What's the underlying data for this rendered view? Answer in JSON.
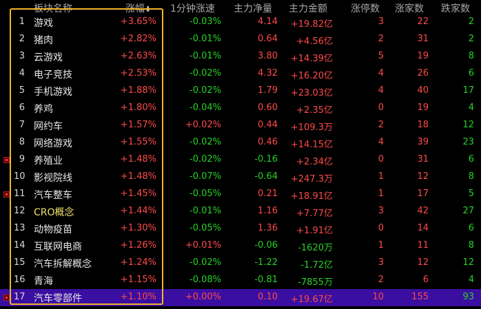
{
  "columns": {
    "name": "板块名称",
    "change": "涨幅",
    "speed": "1分钟涨速",
    "net_flow": "主力净量",
    "amount": "主力金额",
    "limit_up": "涨停数",
    "up": "涨家数",
    "down": "跌家数"
  },
  "rows": [
    {
      "no": "1",
      "name": "游戏",
      "change": "+3.65%",
      "speed": "-0.03%",
      "net": "4.14",
      "amount": "+19.82亿",
      "limit": "3",
      "up": "22",
      "down": "2",
      "marker": false
    },
    {
      "no": "2",
      "name": "猪肉",
      "change": "+2.82%",
      "speed": "-0.01%",
      "net": "0.64",
      "amount": "+4.56亿",
      "limit": "2",
      "up": "31",
      "down": "2",
      "marker": false
    },
    {
      "no": "3",
      "name": "云游戏",
      "change": "+2.63%",
      "speed": "-0.01%",
      "net": "3.80",
      "amount": "+14.39亿",
      "limit": "5",
      "up": "19",
      "down": "8",
      "marker": false
    },
    {
      "no": "4",
      "name": "电子竞技",
      "change": "+2.53%",
      "speed": "-0.02%",
      "net": "4.32",
      "amount": "+16.20亿",
      "limit": "4",
      "up": "26",
      "down": "6",
      "marker": false
    },
    {
      "no": "5",
      "name": "手机游戏",
      "change": "+1.88%",
      "speed": "-0.02%",
      "net": "1.79",
      "amount": "+23.03亿",
      "limit": "4",
      "up": "40",
      "down": "17",
      "marker": false
    },
    {
      "no": "6",
      "name": "养鸡",
      "change": "+1.80%",
      "speed": "-0.04%",
      "net": "0.60",
      "amount": "+2.35亿",
      "limit": "0",
      "up": "19",
      "down": "4",
      "marker": false
    },
    {
      "no": "7",
      "name": "网约车",
      "change": "+1.57%",
      "speed": "+0.02%",
      "net": "0.44",
      "amount": "+109.3万",
      "limit": "2",
      "up": "18",
      "down": "12",
      "marker": false
    },
    {
      "no": "8",
      "name": "网络游戏",
      "change": "+1.55%",
      "speed": "-0.02%",
      "net": "0.46",
      "amount": "+14.15亿",
      "limit": "4",
      "up": "39",
      "down": "23",
      "marker": false
    },
    {
      "no": "9",
      "name": "养殖业",
      "change": "+1.48%",
      "speed": "-0.02%",
      "net": "-0.16",
      "amount": "+2.34亿",
      "limit": "0",
      "up": "31",
      "down": "6",
      "marker": true
    },
    {
      "no": "10",
      "name": "影视院线",
      "change": "+1.48%",
      "speed": "-0.07%",
      "net": "-0.64",
      "amount": "+247.3万",
      "limit": "1",
      "up": "12",
      "down": "8",
      "marker": false
    },
    {
      "no": "11",
      "name": "汽车整车",
      "change": "+1.45%",
      "speed": "-0.05%",
      "net": "0.21",
      "amount": "+18.91亿",
      "limit": "1",
      "up": "17",
      "down": "5",
      "marker": true
    },
    {
      "no": "12",
      "name": "CRO概念",
      "change": "+1.44%",
      "speed": "-0.01%",
      "net": "1.16",
      "amount": "+7.77亿",
      "limit": "3",
      "up": "42",
      "down": "27",
      "marker": false
    },
    {
      "no": "13",
      "name": "动物疫苗",
      "change": "+1.30%",
      "speed": "-0.05%",
      "net": "1.36",
      "amount": "+1.91亿",
      "limit": "0",
      "up": "14",
      "down": "6",
      "marker": false
    },
    {
      "no": "14",
      "name": "互联网电商",
      "change": "+1.26%",
      "speed": "+0.01%",
      "net": "-0.06",
      "amount": "-1620万",
      "limit": "1",
      "up": "11",
      "down": "8",
      "marker": false
    },
    {
      "no": "15",
      "name": "汽车拆解概念",
      "change": "+1.24%",
      "speed": "-0.02%",
      "net": "-1.22",
      "amount": "-1.72亿",
      "limit": "3",
      "up": "12",
      "down": "12",
      "marker": false
    },
    {
      "no": "16",
      "name": "青海",
      "change": "+1.15%",
      "speed": "-0.08%",
      "net": "-0.81",
      "amount": "-7855万",
      "limit": "2",
      "up": "6",
      "down": "4",
      "marker": false
    },
    {
      "no": "17",
      "name": "汽车零部件",
      "change": "+1.10%",
      "speed": "+0.00%",
      "net": "0.10",
      "amount": "+19.67亿",
      "limit": "10",
      "up": "155",
      "down": "93",
      "marker": true
    }
  ],
  "colors": {
    "red": "#ff4a4a",
    "green": "#27d327",
    "yellow": "#f2e06a",
    "cyan": "#58c6ff",
    "selected_row": "#3a0ea0",
    "highlight_box": "#f6b52a"
  },
  "sort_icon": "sort-desc-arrow"
}
